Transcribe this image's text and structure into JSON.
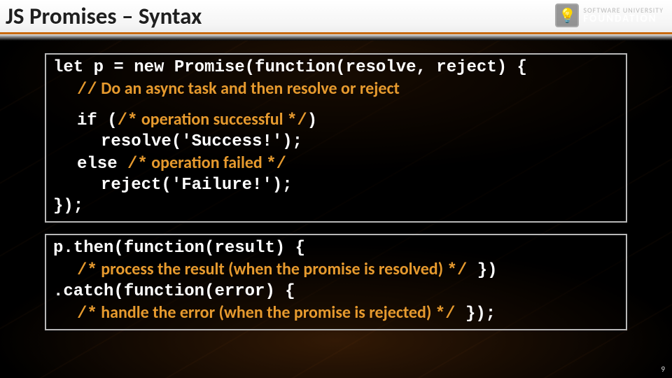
{
  "title": "JS Promises – Syntax",
  "logo": {
    "line1": "SOFTWARE UNIVERSITY",
    "line2": "FOUNDATION",
    "bulb": "💡"
  },
  "box1": {
    "l1a": "let p = ",
    "l1b": "new Promise",
    "l1c": "(function(resolve, reject) {",
    "c1a": "//",
    "c1b": " Do an async task and then resolve or reject",
    "l2a": "if (",
    "c2a": "/*",
    "c2b": " operation successful ",
    "c2c": "*/",
    "l2b": ")",
    "l3": "resolve('Success!');",
    "l4": "else ",
    "c3a": "/*",
    "c3b": " operation failed ",
    "c3c": "*/",
    "l5": "reject('Failure!');",
    "l6": "});"
  },
  "box2": {
    "l1": "p.then(function(result) { ",
    "c1a": "/*",
    "c1b": " process the result (when the promise is resolved) ",
    "c1c": "*/",
    "l1end": " })",
    "l2": ".catch(function(error) { ",
    "c2a": "/*",
    "c2b": " handle the error (when the promise is rejected) ",
    "c2c": "*/",
    "l2end": " });"
  },
  "pagenum": "9"
}
